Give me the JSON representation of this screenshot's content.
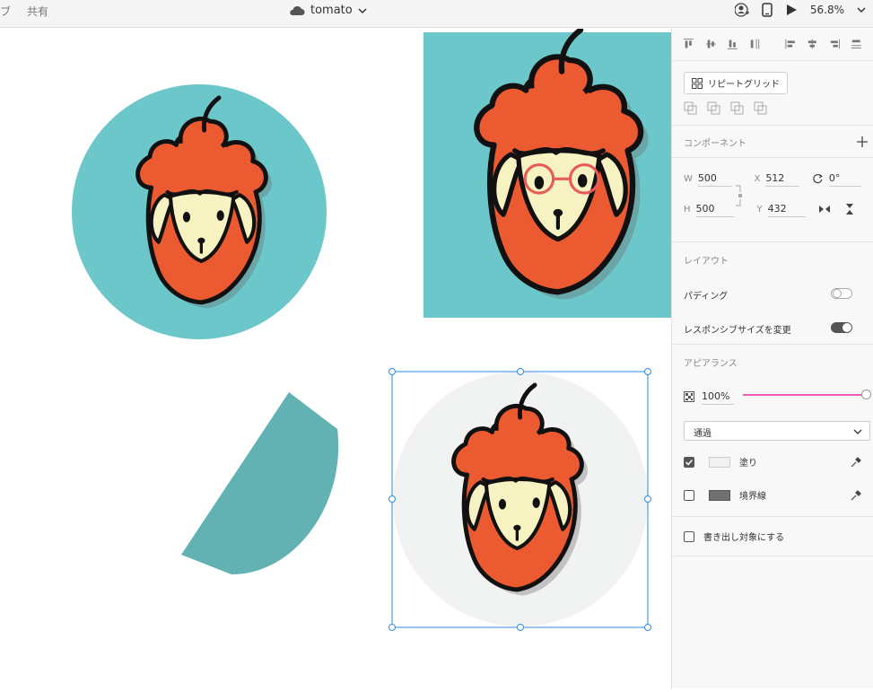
{
  "topbar": {
    "left_items": [
      "ブ",
      "共有"
    ],
    "doc_title": "tomato",
    "zoom": "56.8%"
  },
  "panel": {
    "repeat_grid_label": "リピートグリッド",
    "components_label": "コンポーネント",
    "transform": {
      "w_label": "W",
      "w_value": "500",
      "x_label": "X",
      "x_value": "512",
      "h_label": "H",
      "h_value": "500",
      "y_label": "Y",
      "y_value": "432",
      "rotation": "0°"
    },
    "layout_label": "レイアウト",
    "padding_label": "パディング",
    "responsive_label": "レスポンシブサイズを変更",
    "appearance_label": "アピアランス",
    "opacity": "100%",
    "blend_mode": "通過",
    "fill_label": "塗り",
    "border_label": "境界線",
    "export_label": "書き出し対象にする"
  },
  "colors": {
    "teal": "#6cc7ca",
    "teal_dark": "#63b2b3",
    "tomato": "#eb5a30",
    "cream": "#f6f2c2",
    "selection": "#2d8ae6",
    "toggle_on": "#555555",
    "slider": "#e85db6"
  }
}
